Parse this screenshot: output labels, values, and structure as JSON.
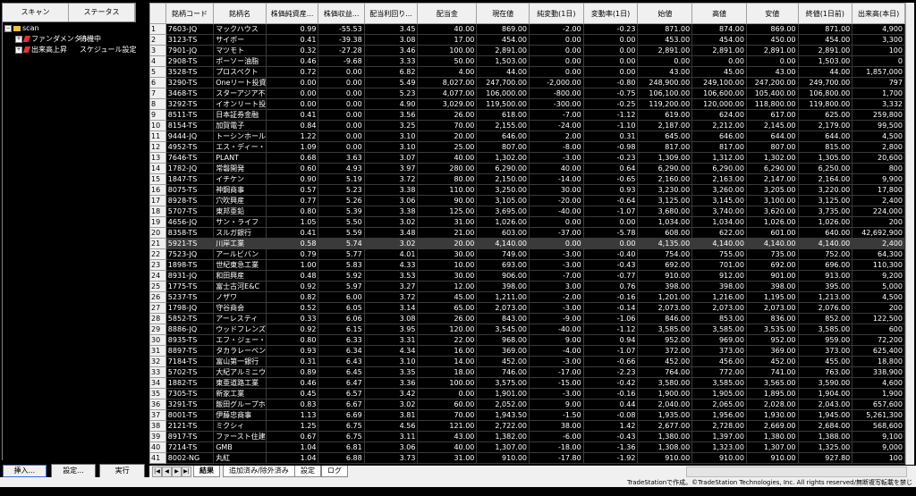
{
  "left_panel": {
    "headers": [
      "スキャン",
      "ステータス"
    ],
    "tree": {
      "root": "scan",
      "items": [
        {
          "label": "ファンダメンタル",
          "status": "待機中"
        },
        {
          "label": "出来高上昇",
          "status": "スケジュール設定"
        }
      ]
    },
    "buttons": [
      "挿入...",
      "設定...",
      "実行"
    ]
  },
  "table": {
    "columns": [
      "銘柄コード",
      "銘柄名",
      "株価純資産...",
      "株価収益...",
      "配当利回り...",
      "配当金",
      "現在値",
      "純変動(1日)",
      "変動率(1日)",
      "始値",
      "高値",
      "安値",
      "終値(1日前)",
      "出来高(本日)"
    ],
    "rows": [
      [
        "7603-JQ",
        "マックハウス",
        "0.99",
        "-55.53",
        "3.45",
        "40.00",
        "869.00",
        "-2.00",
        "-0.23",
        "871.00",
        "874.00",
        "869.00",
        "871.00",
        "4,900"
      ],
      [
        "3123-TS",
        "サイボー",
        "0.41",
        "-39.38",
        "3.08",
        "17.00",
        "454.00",
        "0.00",
        "0.00",
        "453.00",
        "454.00",
        "450.00",
        "454.00",
        "3,300"
      ],
      [
        "7901-JQ",
        "マツモト",
        "0.32",
        "-27.28",
        "3.46",
        "100.00",
        "2,891.00",
        "0.00",
        "0.00",
        "2,891.00",
        "2,891.00",
        "2,891.00",
        "2,891.00",
        "100"
      ],
      [
        "2908-TS",
        "ポーソー油脂",
        "0.46",
        "-9.68",
        "3.33",
        "50.00",
        "1,503.00",
        "0.00",
        "0.00",
        "0.00",
        "0.00",
        "0.00",
        "1,503.00",
        "0"
      ],
      [
        "3528-TS",
        "プロスペクト",
        "0.72",
        "0.00",
        "6.82",
        "4.00",
        "44.00",
        "0.00",
        "0.00",
        "43.00",
        "45.00",
        "43.00",
        "44.00",
        "1,857,000"
      ],
      [
        "3290-TS",
        "Oneリート投資",
        "0.00",
        "0.00",
        "5.49",
        "8,027.00",
        "247,700.00",
        "-2,000.00",
        "-0.80",
        "248,900.00",
        "249,100.00",
        "247,200.00",
        "249,700.00",
        "797"
      ],
      [
        "3468-TS",
        "スターアジア不動",
        "0.00",
        "0.00",
        "5.23",
        "4,077.00",
        "106,000.00",
        "-800.00",
        "-0.75",
        "106,100.00",
        "106,600.00",
        "105,400.00",
        "106,800.00",
        "1,700"
      ],
      [
        "3292-TS",
        "イオンリート投資",
        "0.00",
        "0.00",
        "4.90",
        "3,029.00",
        "119,500.00",
        "-300.00",
        "-0.25",
        "119,200.00",
        "120,000.00",
        "118,800.00",
        "119,800.00",
        "3,332"
      ],
      [
        "8511-TS",
        "日本証券金融",
        "0.41",
        "0.00",
        "3.56",
        "26.00",
        "618.00",
        "-7.00",
        "-1.12",
        "619.00",
        "624.00",
        "617.00",
        "625.00",
        "259,800"
      ],
      [
        "8154-TS",
        "加賀電子",
        "0.84",
        "0.00",
        "3.25",
        "70.00",
        "2,155.00",
        "-24.00",
        "-1.10",
        "2,187.00",
        "2,212.00",
        "2,145.00",
        "2,179.00",
        "99,500"
      ],
      [
        "9444-JQ",
        "トーシンホールデ",
        "1.22",
        "0.00",
        "3.10",
        "20.00",
        "646.00",
        "2.00",
        "0.31",
        "645.00",
        "646.00",
        "644.00",
        "644.00",
        "4,500"
      ],
      [
        "4952-TS",
        "エス・ディー・エス",
        "1.09",
        "0.00",
        "3.10",
        "25.00",
        "807.00",
        "-8.00",
        "-0.98",
        "817.00",
        "817.00",
        "807.00",
        "815.00",
        "2,800"
      ],
      [
        "7646-TS",
        "PLANT",
        "0.68",
        "3.63",
        "3.07",
        "40.00",
        "1,302.00",
        "-3.00",
        "-0.23",
        "1,309.00",
        "1,312.00",
        "1,302.00",
        "1,305.00",
        "20,600"
      ],
      [
        "1782-JQ",
        "常磐開発",
        "0.60",
        "4.93",
        "3.97",
        "280.00",
        "6,290.00",
        "40.00",
        "0.64",
        "6,290.00",
        "6,290.00",
        "6,290.00",
        "6,250.00",
        "800"
      ],
      [
        "1847-TS",
        "イチケン",
        "0.90",
        "5.19",
        "3.72",
        "80.00",
        "2,150.00",
        "-14.00",
        "-0.65",
        "2,160.00",
        "2,163.00",
        "2,147.00",
        "2,164.00",
        "9,900"
      ],
      [
        "8075-TS",
        "神鋼商事",
        "0.57",
        "5.23",
        "3.38",
        "110.00",
        "3,250.00",
        "30.00",
        "0.93",
        "3,230.00",
        "3,260.00",
        "3,205.00",
        "3,220.00",
        "17,800"
      ],
      [
        "8928-TS",
        "穴吹興産",
        "0.77",
        "5.26",
        "3.06",
        "90.00",
        "3,105.00",
        "-20.00",
        "-0.64",
        "3,125.00",
        "3,145.00",
        "3,100.00",
        "3,125.00",
        "2,400"
      ],
      [
        "5707-TS",
        "東邦亜鉛",
        "0.80",
        "5.39",
        "3.38",
        "125.00",
        "3,695.00",
        "-40.00",
        "-1.07",
        "3,680.00",
        "3,740.00",
        "3,620.00",
        "3,735.00",
        "224,000"
      ],
      [
        "4656-JQ",
        "サン・ライフ",
        "1.05",
        "5.50",
        "3.02",
        "31.00",
        "1,026.00",
        "0.00",
        "0.00",
        "1,034.00",
        "1,034.00",
        "1,026.00",
        "1,026.00",
        "200"
      ],
      [
        "8358-TS",
        "スルガ銀行",
        "0.41",
        "5.59",
        "3.48",
        "21.00",
        "603.00",
        "-37.00",
        "-5.78",
        "608.00",
        "622.00",
        "601.00",
        "640.00",
        "42,692,900"
      ],
      [
        "5921-TS",
        "川岸工業",
        "0.58",
        "5.74",
        "3.02",
        "20.00",
        "4,140.00",
        "0.00",
        "0.00",
        "4,135.00",
        "4,140.00",
        "4,140.00",
        "4,140.00",
        "2,400"
      ],
      [
        "7523-JQ",
        "アールビバン",
        "0.79",
        "5.77",
        "4.01",
        "30.00",
        "749.00",
        "-3.00",
        "-0.40",
        "754.00",
        "755.00",
        "735.00",
        "752.00",
        "64,300"
      ],
      [
        "1898-TS",
        "世紀東急工業",
        "1.00",
        "5.83",
        "4.33",
        "10.00",
        "693.00",
        "-3.00",
        "-0.43",
        "692.00",
        "701.00",
        "692.00",
        "696.00",
        "110,300"
      ],
      [
        "8931-JQ",
        "和田興産",
        "0.48",
        "5.92",
        "3.53",
        "30.00",
        "906.00",
        "-7.00",
        "-0.77",
        "910.00",
        "912.00",
        "901.00",
        "913.00",
        "9,200"
      ],
      [
        "1775-TS",
        "富士古河E&C",
        "0.92",
        "5.97",
        "3.27",
        "12.00",
        "398.00",
        "3.00",
        "0.76",
        "398.00",
        "398.00",
        "398.00",
        "395.00",
        "5,000"
      ],
      [
        "5237-TS",
        "ノザワ",
        "0.82",
        "6.00",
        "3.72",
        "45.00",
        "1,211.00",
        "-2.00",
        "-0.16",
        "1,201.00",
        "1,216.00",
        "1,195.00",
        "1,213.00",
        "4,500"
      ],
      [
        "1798-JQ",
        "守谷商会",
        "0.52",
        "6.05",
        "3.14",
        "65.00",
        "2,073.00",
        "-3.00",
        "-0.14",
        "2,073.00",
        "2,073.00",
        "2,073.00",
        "2,076.00",
        "200"
      ],
      [
        "5852-TS",
        "アーレスティ",
        "0.33",
        "6.06",
        "3.08",
        "26.00",
        "843.00",
        "-9.00",
        "-1.06",
        "846.00",
        "853.00",
        "836.00",
        "852.00",
        "122,500"
      ],
      [
        "8886-JQ",
        "ウッドフレンズ",
        "0.92",
        "6.15",
        "3.95",
        "120.00",
        "3,545.00",
        "-40.00",
        "-1.12",
        "3,585.00",
        "3,585.00",
        "3,535.00",
        "3,585.00",
        "600"
      ],
      [
        "8935-TS",
        "エフ・ジェー・ネク",
        "0.80",
        "6.33",
        "3.31",
        "22.00",
        "968.00",
        "9.00",
        "0.94",
        "952.00",
        "969.00",
        "952.00",
        "959.00",
        "72,200"
      ],
      [
        "8897-TS",
        "タカラレーベン",
        "0.93",
        "6.34",
        "4.34",
        "16.00",
        "369.00",
        "-4.00",
        "-1.07",
        "372.00",
        "373.00",
        "369.00",
        "373.00",
        "625,400"
      ],
      [
        "7184-TS",
        "富山第一銀行",
        "0.31",
        "6.43",
        "3.10",
        "14.00",
        "452.00",
        "-3.00",
        "-0.66",
        "452.00",
        "456.00",
        "452.00",
        "455.00",
        "18,800"
      ],
      [
        "5702-TS",
        "大紀アルミニウム",
        "0.89",
        "6.45",
        "3.35",
        "18.00",
        "746.00",
        "-17.00",
        "-2.23",
        "764.00",
        "772.00",
        "741.00",
        "763.00",
        "338,900"
      ],
      [
        "1882-TS",
        "東亜道路工業",
        "0.46",
        "6.47",
        "3.36",
        "100.00",
        "3,575.00",
        "-15.00",
        "-0.42",
        "3,580.00",
        "3,585.00",
        "3,565.00",
        "3,590.00",
        "4,600"
      ],
      [
        "7305-TS",
        "新家工業",
        "0.45",
        "6.57",
        "3.42",
        "0.00",
        "1,901.00",
        "-3.00",
        "-0.16",
        "1,900.00",
        "1,905.00",
        "1,895.00",
        "1,904.00",
        "1,900"
      ],
      [
        "3291-TS",
        "飯田グループホ",
        "0.83",
        "6.67",
        "3.02",
        "60.00",
        "2,052.00",
        "9.00",
        "0.44",
        "2,040.00",
        "2,065.00",
        "2,028.00",
        "2,043.00",
        "657,600"
      ],
      [
        "8001-TS",
        "伊藤忠商事",
        "1.13",
        "6.69",
        "3.81",
        "70.00",
        "1,943.50",
        "-1.50",
        "-0.08",
        "1,935.00",
        "1,956.00",
        "1,930.00",
        "1,945.00",
        "5,261,300"
      ],
      [
        "2121-TS",
        "ミクシィ",
        "1.25",
        "6.75",
        "4.56",
        "121.00",
        "2,722.00",
        "38.00",
        "1.42",
        "2,677.00",
        "2,728.00",
        "2,669.00",
        "2,684.00",
        "568,600"
      ],
      [
        "8917-TS",
        "ファースト住建",
        "0.67",
        "6.75",
        "3.11",
        "43.00",
        "1,382.00",
        "-6.00",
        "-0.43",
        "1,380.00",
        "1,397.00",
        "1,380.00",
        "1,388.00",
        "9,100"
      ],
      [
        "7214-TS",
        "GMB",
        "1.04",
        "6.81",
        "3.06",
        "40.00",
        "1,307.00",
        "-18.00",
        "-1.36",
        "1,308.00",
        "1,323.00",
        "1,307.00",
        "1,325.00",
        "9,000"
      ],
      [
        "8002-NG",
        "丸紅",
        "1.04",
        "6.88",
        "3.73",
        "31.00",
        "910.00",
        "-17.80",
        "-1.92",
        "910.00",
        "910.00",
        "910.00",
        "927.80",
        "100"
      ]
    ],
    "selected_row": 20
  },
  "tabs": [
    "結果",
    "追加済み/除外済み",
    "設定",
    "ログ"
  ],
  "footer": {
    "copyright": "TradeStationで作成。©TradeStation Technologies, Inc. All rights reserved/無断複写転載を禁じます。"
  }
}
